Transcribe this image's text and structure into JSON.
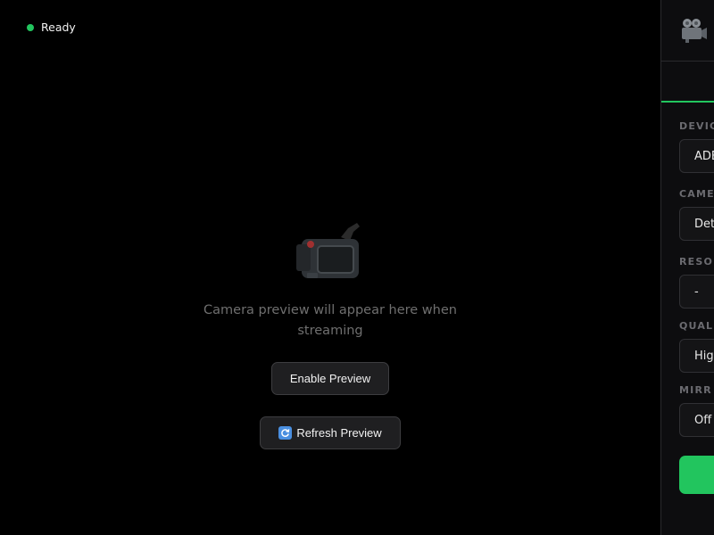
{
  "status": {
    "text": "Ready",
    "color": "#22c55e"
  },
  "preview": {
    "placeholder_icon": "video-camera-icon",
    "placeholder_text": "Camera preview will appear here when streaming",
    "enable_label": "Enable Preview",
    "refresh_icon": "refresh-icon",
    "refresh_label": "Refresh Preview"
  },
  "sidebar": {
    "logo_icon": "movie-camera-icon",
    "accent_color": "#22c55e",
    "fields": [
      {
        "label": "DEVIC",
        "value": "ADB"
      },
      {
        "label": "CAME",
        "value": "Det"
      },
      {
        "label": "RESOL",
        "value": "-"
      },
      {
        "label": "QUAL",
        "value": "Hig"
      },
      {
        "label": "MIRR",
        "value": "Off"
      }
    ]
  }
}
